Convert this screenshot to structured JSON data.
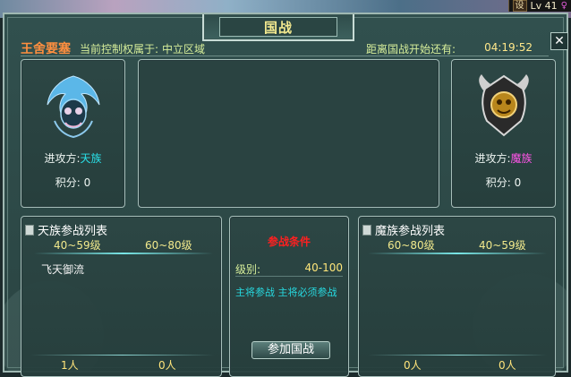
{
  "hud": {
    "btn": "设",
    "level": "Lv 41"
  },
  "window": {
    "title": "国战",
    "close": "✕"
  },
  "info": {
    "fortress": "王舍要塞",
    "control_label": "当前控制权属于:",
    "control_value": "中立区域",
    "countdown_label": "距离国战开始还有:",
    "countdown_value": "04:19:52"
  },
  "left_attacker": {
    "label": "进攻方:",
    "faction": "天族",
    "score_label": "积分:",
    "score": "0"
  },
  "right_attacker": {
    "label": "进攻方:",
    "faction": "魔族",
    "score_label": "积分:",
    "score": "0"
  },
  "left_list": {
    "title": "天族参战列表",
    "col1": "40~59级",
    "col2": "60~80级",
    "entries": [
      "飞天御流"
    ],
    "count1": "1人",
    "count2": "0人"
  },
  "right_list": {
    "title": "魔族参战列表",
    "col1": "60~80级",
    "col2": "40~59级",
    "count1": "0人",
    "count2": "0人"
  },
  "conditions": {
    "title": "参战条件",
    "level_label": "级别:",
    "level_value": "40-100",
    "note": "主将参战 主将必须参战",
    "join_button": "参加国战"
  },
  "colors": {
    "faction_tian": "#29e0e8",
    "faction_mo": "#ff55e8",
    "title_gold": "#f3e98f",
    "fortress_orange": "#ff8f3f"
  }
}
